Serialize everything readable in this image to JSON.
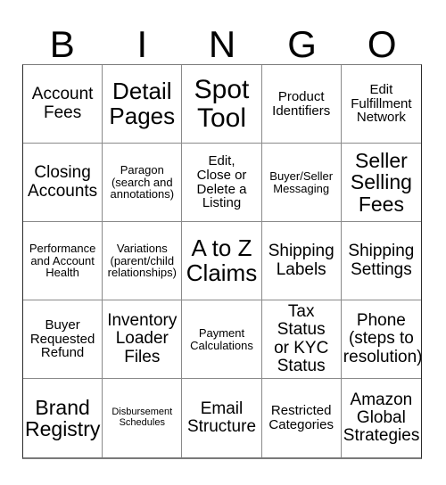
{
  "card": {
    "header_letters": [
      "B",
      "I",
      "N",
      "G",
      "O"
    ],
    "columns": 5,
    "rows": 5,
    "text_color": "#000000",
    "background_color": "#ffffff",
    "border_color": "#8a8a8a"
  },
  "cells": [
    {
      "text": "Account\nFees",
      "size": "md"
    },
    {
      "text": "Detail\nPages",
      "size": "xl"
    },
    {
      "text": "Spot\nTool",
      "size": "xxl"
    },
    {
      "text": "Product\nIdentifiers",
      "size": "sm"
    },
    {
      "text": "Edit\nFulfillment\nNetwork",
      "size": "sm"
    },
    {
      "text": "Closing\nAccounts",
      "size": "md"
    },
    {
      "text": "Paragon\n(search and\nannotations)",
      "size": "xs"
    },
    {
      "text": "Edit,\nClose or\nDelete a\nListing",
      "size": "sm"
    },
    {
      "text": "Buyer/Seller\nMessaging",
      "size": "xs"
    },
    {
      "text": "Seller\nSelling\nFees",
      "size": "lg"
    },
    {
      "text": "Performance\nand Account\nHealth",
      "size": "xs"
    },
    {
      "text": "Variations\n(parent/child\nrelationships)",
      "size": "xs"
    },
    {
      "text": "A to Z\nClaims",
      "size": "xl"
    },
    {
      "text": "Shipping\nLabels",
      "size": "md"
    },
    {
      "text": "Shipping\nSettings",
      "size": "md"
    },
    {
      "text": "Buyer\nRequested\nRefund",
      "size": "sm"
    },
    {
      "text": "Inventory\nLoader\nFiles",
      "size": "md"
    },
    {
      "text": "Payment\nCalculations",
      "size": "xs"
    },
    {
      "text": "Tax Status\nor KYC\nStatus",
      "size": "md"
    },
    {
      "text": "Phone\n(steps to\nresolution)",
      "size": "md"
    },
    {
      "text": "Brand\nRegistry",
      "size": "lg"
    },
    {
      "text": "Disbursement\nSchedules",
      "size": "xxs"
    },
    {
      "text": "Email\nStructure",
      "size": "md"
    },
    {
      "text": "Restricted\nCategories",
      "size": "sm"
    },
    {
      "text": "Amazon\nGlobal\nStrategies",
      "size": "md"
    }
  ]
}
